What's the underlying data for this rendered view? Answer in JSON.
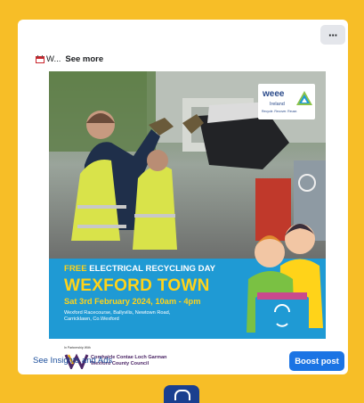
{
  "post": {
    "more_label": "···",
    "caption_snippet": "W...",
    "see_more": "See more"
  },
  "poster": {
    "brand": {
      "name": "weee",
      "sub": "Ireland",
      "tagline": "Recycle. Recover. Reuse."
    },
    "free_word": "FREE",
    "headline": "ELECTRICAL RECYCLING DAY",
    "town": "WEXFORD TOWN",
    "date": "Sat 3rd February 2024, 10am - 4pm",
    "address_line1": "Wexford Racecourse, Ballyvilis, Newtown Road,",
    "address_line2": "Carricklawn, Co.Wexford",
    "partner_intro": "In Partnership With",
    "partner_name1": "Comhairle Contae Loch Garman",
    "partner_name2": "Wexford County Council"
  },
  "footer": {
    "insights_label": "See Insights and Ads",
    "boost_label": "Boost post"
  },
  "colors": {
    "background": "#f7be27",
    "poster_blue": "#1f9ad4",
    "accent_yellow": "#ffd319",
    "facebook_blue": "#1b74e4"
  }
}
